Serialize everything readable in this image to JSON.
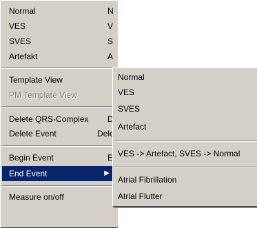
{
  "main_menu": {
    "items": [
      {
        "label": "Normal",
        "accel": "N"
      },
      {
        "label": "VES",
        "accel": "V"
      },
      {
        "label": "SVES",
        "accel": "S"
      },
      {
        "label": "Artefakt",
        "accel": "A"
      },
      {
        "label": "Template View"
      },
      {
        "label": "PM Template View"
      },
      {
        "label": "Delete QRS-Complex",
        "accel": "D"
      },
      {
        "label": "Delete Event",
        "accel": "Delete"
      },
      {
        "label": "Begin Event",
        "accel": "E"
      },
      {
        "label": "End Event"
      },
      {
        "label": "Measure on/off"
      }
    ]
  },
  "sub_menu": {
    "items": [
      {
        "label": "Normal"
      },
      {
        "label": "VES"
      },
      {
        "label": "SVES"
      },
      {
        "label": "Artefact"
      },
      {
        "label": "VES -> Artefact, SVES -> Normal"
      },
      {
        "label": "Atrial Fibrillation"
      },
      {
        "label": "Atrial Flutter"
      }
    ]
  },
  "colors": {
    "menu_bg": "#d4d0c8",
    "highlight": "#0a246a",
    "disabled_text": "#808080"
  }
}
